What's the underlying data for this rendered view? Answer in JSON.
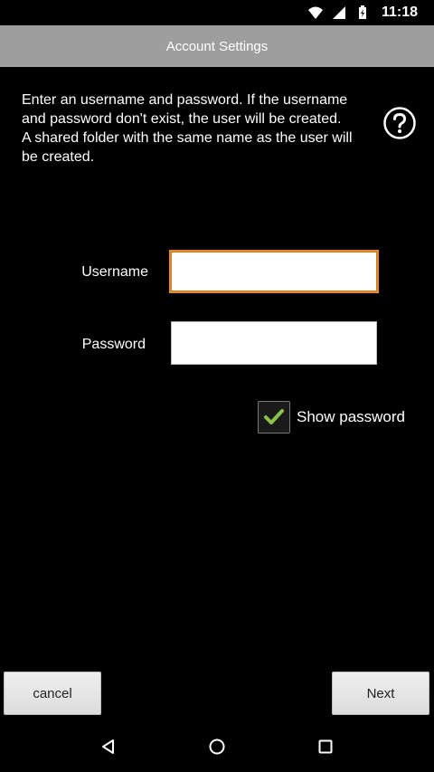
{
  "status_bar": {
    "time": "11:18",
    "icons": [
      "wifi-icon",
      "signal-icon",
      "battery-icon"
    ]
  },
  "title_bar": {
    "title": "Account Settings"
  },
  "description": {
    "line1": "Enter an username and password. If the username and password don't exist, the user will be created.",
    "line2": "A shared folder with the same name as the user will be created."
  },
  "help": {
    "icon": "help-icon"
  },
  "form": {
    "username_label": "Username",
    "username_value": "",
    "password_label": "Password",
    "password_value": "",
    "show_password_label": "Show password",
    "show_password_checked": true
  },
  "buttons": {
    "cancel_label": "cancel",
    "next_label": "Next"
  },
  "nav_bar": {
    "icons": [
      "back-icon",
      "home-icon",
      "recents-icon"
    ]
  },
  "colors": {
    "title_bar_bg": "#9e9e9e",
    "focus_border": "#e38b2c",
    "check_color": "#8bc34a",
    "background": "#000000"
  }
}
